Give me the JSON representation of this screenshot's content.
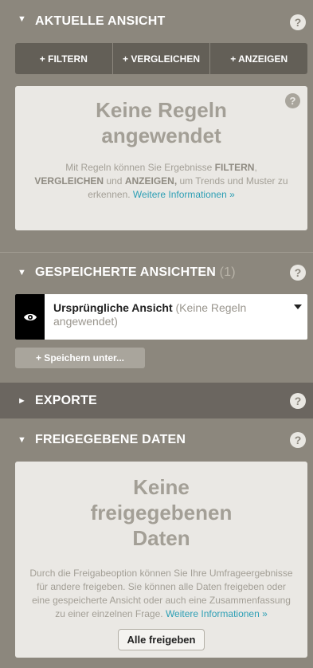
{
  "current_view": {
    "title": "AKTUELLE ANSICHT",
    "help": "?",
    "buttons": [
      "+ FILTERN",
      "+ VERGLEICHEN",
      "+ ANZEIGEN"
    ],
    "empty": {
      "title": "Keine Regeln angewendet",
      "text_1": "Mit Regeln können Sie Ergebnisse ",
      "filtern": "FILTERN",
      "text_2": ",",
      "vergleichen": "VERGLEICHEN",
      "text_3": " und ",
      "anzeigen": "ANZEIGEN,",
      "text_4": " um Trends und Muster zu erkennen. ",
      "link": "Weitere Informationen »"
    }
  },
  "saved_views": {
    "title": "GESPEICHERTE ANSICHTEN",
    "count": "(1)",
    "help": "?",
    "item": {
      "name": "Ursprüngliche Ansicht",
      "detail": "(Keine Regeln angewendet)"
    },
    "save_as": "+ Speichern unter..."
  },
  "exports": {
    "title": "EXPORTE",
    "help": "?"
  },
  "shared_data": {
    "title": "FREIGEGEBENE DATEN",
    "help": "?",
    "empty": {
      "title": "Keine freigegebenen Daten",
      "text": "Durch die Freigabeoption können Sie Ihre Umfrageergebnisse für andere freigeben. Sie können alle Daten freigeben oder eine gespeicherte Ansicht oder auch eine Zusammenfassung zu einer einzelnen Frage. ",
      "link": "Weitere Informationen »",
      "button": "Alle freigeben"
    }
  },
  "colors": {
    "panel_bg": "#8c877d",
    "dark_bar": "#6b6660",
    "button_row": "#635f57",
    "link": "#2d9fb5"
  }
}
